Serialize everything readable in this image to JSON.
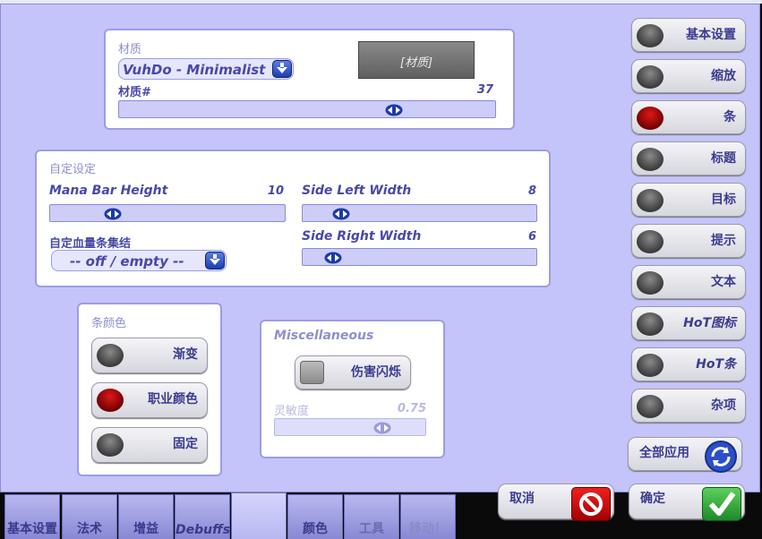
{
  "texture_panel": {
    "label": "材质",
    "dropdown_value": "VuhDo - Minimalist",
    "preview_label": "[材质]",
    "number_label": "材质#",
    "number_value": "37",
    "number_slider": 0.6
  },
  "custom_panel": {
    "label": "自定设定",
    "mana_bar_height_label": "Mana Bar Height",
    "mana_bar_height_value": "10",
    "mana_bar_height_slider": 0.27,
    "side_left_width_label": "Side Left Width",
    "side_left_width_value": "8",
    "side_left_width_slider": 0.17,
    "side_right_width_label": "Side Right Width",
    "side_right_width_value": "6",
    "side_right_width_slider": 0.13,
    "health_bar_label": "自定血量条集结",
    "health_bar_dropdown": "-- off / empty --"
  },
  "bar_color_panel": {
    "label": "条颜色",
    "options": [
      {
        "label": "渐变",
        "active": false
      },
      {
        "label": "职业颜色",
        "active": true
      },
      {
        "label": "固定",
        "active": false
      }
    ]
  },
  "misc_panel": {
    "label": "Miscellaneous",
    "flash_label": "伤害闪烁",
    "sensitivity_label": "灵敏度",
    "sensitivity_value": "0.75",
    "sensitivity_slider": 0.65
  },
  "side_menu": [
    {
      "label": "基本设置",
      "active": false
    },
    {
      "label": "缩放",
      "active": false
    },
    {
      "label": "条",
      "active": true
    },
    {
      "label": "标题",
      "active": false
    },
    {
      "label": "目标",
      "active": false
    },
    {
      "label": "提示",
      "active": false
    },
    {
      "label": "文本",
      "active": false
    },
    {
      "label": "HoT图标",
      "active": false
    },
    {
      "label": "HoT条",
      "active": false
    },
    {
      "label": "杂项",
      "active": false
    }
  ],
  "apply_all_label": "全部应用",
  "cancel_label": "取消",
  "ok_label": "确定",
  "tabs": [
    "基本设置",
    "法术",
    "增益",
    "Debuffs",
    "",
    "颜色",
    "工具",
    "移动！"
  ],
  "colors": {
    "background": "#c4c4fa",
    "accent_red": "#d01010",
    "accent_blue": "#2c4fc6",
    "accent_green": "#2ea63a"
  }
}
